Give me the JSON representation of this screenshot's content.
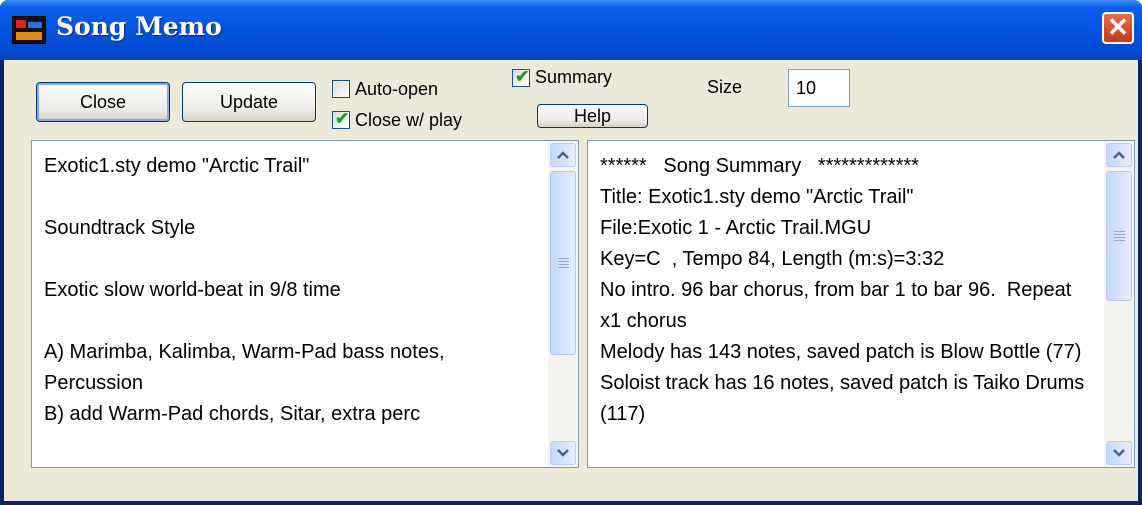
{
  "window": {
    "title": "Song Memo",
    "close_glyph": "✕",
    "icon": "band-in-a-box-icon"
  },
  "toolbar": {
    "close_label": "Close",
    "update_label": "Update",
    "help_label": "Help",
    "auto_open_label": "Auto-open",
    "auto_open_checked": false,
    "close_w_play_label": "Close w/ play",
    "close_w_play_checked": true,
    "summary_label": "Summary",
    "summary_checked": true,
    "size_label": "Size",
    "size_value": "10"
  },
  "memo": {
    "text": "Exotic1.sty demo \"Arctic Trail\"\n\nSoundtrack Style\n\nExotic slow world-beat in 9/8 time\n\nA) Marimba, Kalimba, Warm-Pad bass notes, Percussion\nB) add Warm-Pad chords, Sitar, extra perc"
  },
  "summary": {
    "text": "******   Song Summary   *************\nTitle: Exotic1.sty demo \"Arctic Trail\"\nFile:Exotic 1 - Arctic Trail.MGU\nKey=C  , Tempo 84, Length (m:s)=3:32\nNo intro. 96 bar chorus, from bar 1 to bar 96.  Repeat x1 chorus\nMelody has 143 notes, saved patch is Blow Bottle (77)\nSoloist track has 16 notes, saved patch is Taiko Drums (117)"
  },
  "icons": {
    "check": "✔",
    "scroll_up": "▲",
    "scroll_down": "▼"
  },
  "colors": {
    "titlebar": "#0454e0",
    "dialog_bg": "#ece9d8",
    "checkmark": "#21a121",
    "close_button": "#c4391b"
  }
}
